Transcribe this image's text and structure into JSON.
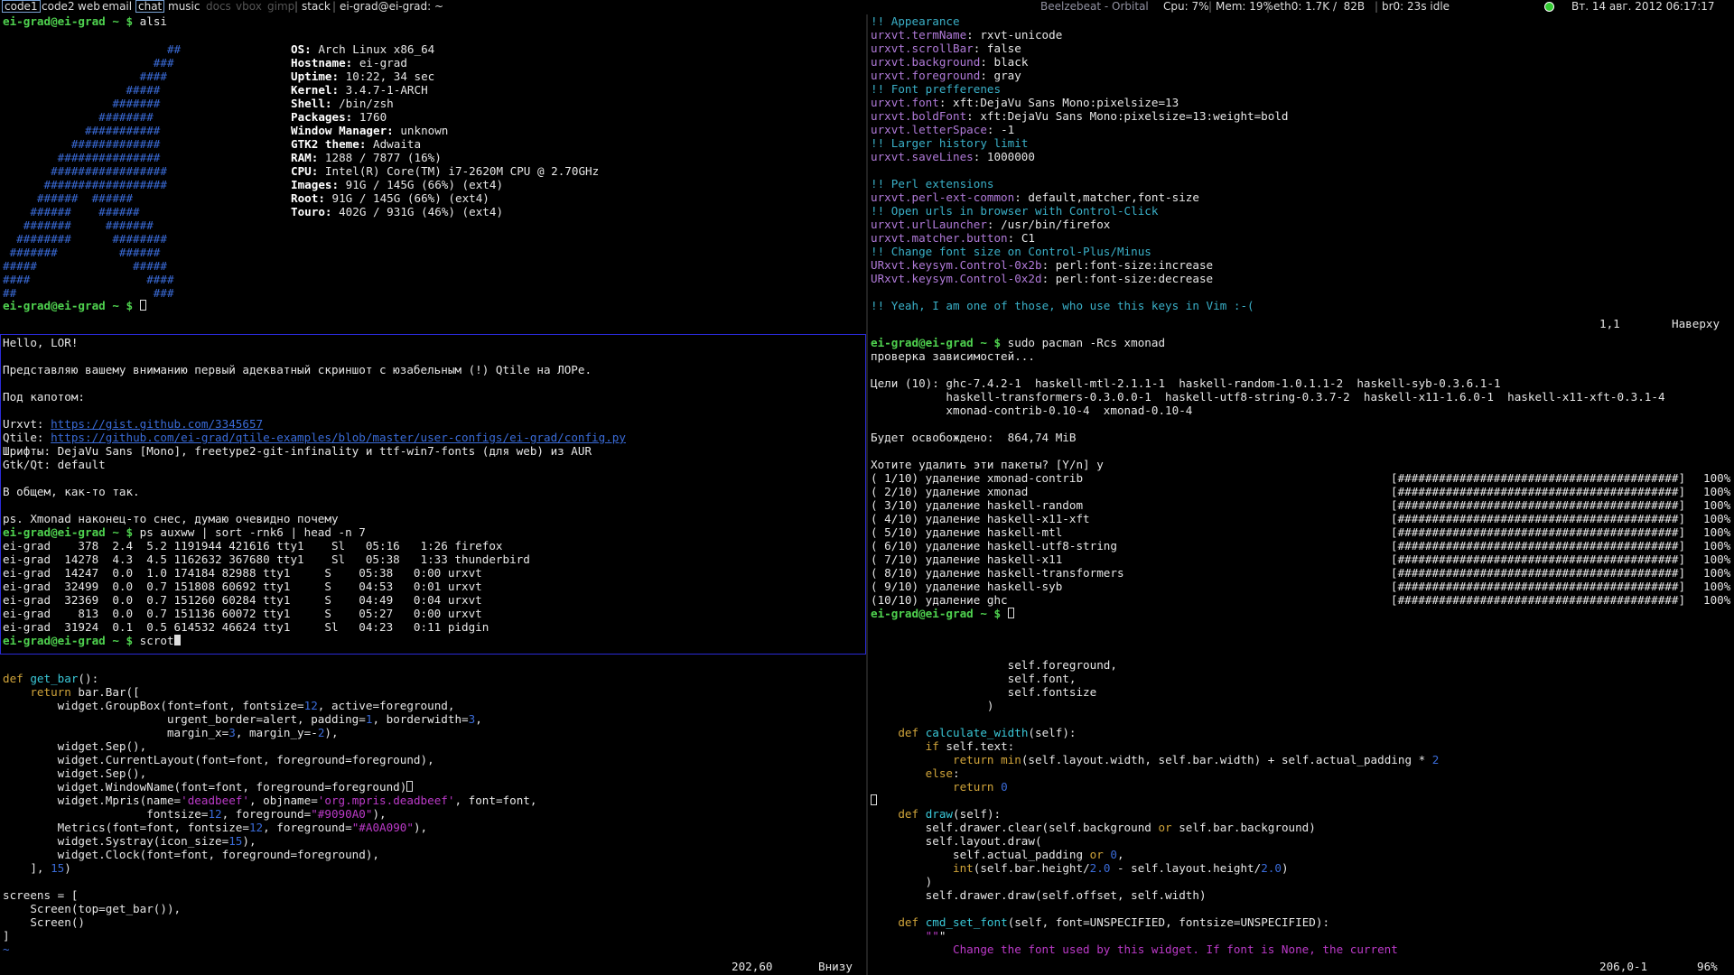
{
  "topbar": {
    "groups": [
      "code1",
      "code2",
      "web",
      "email",
      "chat",
      "music",
      "docs",
      "vbox",
      "gimp"
    ],
    "active_group": "code1",
    "current_group": "chat",
    "layout": "stack",
    "window_title": "ei-grad@ei-grad: ~",
    "now_playing": "Beelzebeat - Orbital",
    "cpu": "Cpu: 7%",
    "mem": "Mem: 19%",
    "eth0": "eth0: 1.7K /  82B",
    "br0": "br0: 23s idle",
    "clock": "Вт. 14 авг. 2012 06:17:17"
  },
  "colors": {
    "prompt": "#4fd24f",
    "path": "#3a6bd8",
    "focus_border": "#2a2ad8",
    "background": "#000000"
  },
  "alsi": {
    "prompt": "ei-grad@ei-grad ~ $ ",
    "command": "alsi",
    "logo": [
      "        ##",
      "       ###",
      "      ####",
      "     #####",
      "    #######",
      "   ########",
      "  ###########",
      " #############",
      "###############",
      "#################",
      "##################",
      "######  ######",
      "######    ######",
      "#######     #######",
      "########      ########",
      "#######         ######",
      "#####              #####",
      "####                 ####",
      "##                    ###"
    ],
    "info": [
      {
        "k": "OS:",
        "v": " Arch Linux x86_64"
      },
      {
        "k": "Hostname:",
        "v": " ei-grad"
      },
      {
        "k": "Uptime:",
        "v": " 10:22, 34 sec"
      },
      {
        "k": "Kernel:",
        "v": " 3.4.7-1-ARCH"
      },
      {
        "k": "Shell:",
        "v": " /bin/zsh"
      },
      {
        "k": "Packages:",
        "v": " 1760"
      },
      {
        "k": "Window Manager:",
        "v": " unknown"
      },
      {
        "k": "GTK2 theme:",
        "v": " Adwaita"
      },
      {
        "k": "RAM:",
        "v": " 1288 / 7877 (16%)"
      },
      {
        "k": "CPU:",
        "v": " Intel(R) Core(TM) i7-2620M CPU @ 2.70GHz"
      },
      {
        "k": "Images:",
        "v": " 91G / 145G (66%) (ext4)"
      },
      {
        "k": "Root:",
        "v": " 91G / 145G (66%) (ext4)"
      },
      {
        "k": "Touro:",
        "v": " 402G / 931G (46%) (ext4)"
      }
    ],
    "prompt2": "ei-grad@ei-grad ~ $ "
  },
  "xres": {
    "lines": [
      [
        "!",
        "! Appearance"
      ],
      [
        "urxvt.termName",
        ": rxvt-unicode"
      ],
      [
        "urxvt.scrollBar",
        ": false"
      ],
      [
        "urxvt.background",
        ": black"
      ],
      [
        "urxvt.foreground",
        ": gray"
      ],
      [
        "!",
        "! Font prefferenes"
      ],
      [
        "urxvt.font",
        ": xft:DejaVu Sans Mono:pixelsize=13"
      ],
      [
        "urxvt.boldFont",
        ": xft:DejaVu Sans Mono:pixelsize=13:weight=bold"
      ],
      [
        "urxvt.letterSpace",
        ": -1"
      ],
      [
        "!",
        "! Larger history limit"
      ],
      [
        "urxvt.saveLines",
        ": 1000000"
      ],
      [
        "",
        ""
      ],
      [
        "!",
        "! Perl extensions"
      ],
      [
        "urxvt.perl-ext-common",
        ": default,matcher,font-size"
      ],
      [
        "!",
        "! Open urls in browser with Control-Click"
      ],
      [
        "urxvt.urlLauncher",
        ": /usr/bin/firefox"
      ],
      [
        "urxvt.matcher.button",
        ": C1"
      ],
      [
        "!",
        "! Change font size on Control-Plus/Minus"
      ],
      [
        "URxvt.keysym.Control-0x2b",
        ": perl:font-size:increase"
      ],
      [
        "URxvt.keysym.Control-0x2d",
        ": perl:font-size:decrease"
      ],
      [
        "",
        ""
      ],
      [
        "!",
        "! Yeah, I am one of those, who use this keys in Vim :-("
      ]
    ],
    "status_pos": "1,1",
    "status_where": "Наверху"
  },
  "lor": {
    "text": [
      "Hello, LOR!",
      "",
      "Представляю вашему вниманию первый адекватный скриншот с юзабельным (!) Qtile на ЛОРе.",
      "",
      "Под капотом:",
      ""
    ],
    "urxvt_label": "Urxvt: ",
    "urxvt_link": "https://gist.github.com/3345657",
    "qtile_label": "Qtile: ",
    "qtile_link": "https://github.com/ei-grad/qtile-examples/blob/master/user-configs/ei-grad/config.py",
    "text2": [
      "Шрифты: DejaVu Sans [Mono], freetype2-git-infinality и ttf-win7-fonts (для web) из AUR",
      "Gtk/Qt: default",
      "",
      "В общем, как-то так.",
      "",
      "ps. Xmonad наконец-то снес, думаю очевидно почему"
    ],
    "prompt": "ei-grad@ei-grad ~ $ ",
    "command": "ps auxww | sort -rnk6 | head -n 7",
    "ps": [
      "ei-grad    378  2.4  5.2 1191944 421616 tty1    Sl   05:16   1:26 firefox",
      "ei-grad  14278  4.3  4.5 1162632 367680 tty1    Sl   05:38   1:33 thunderbird",
      "ei-grad  14247  0.0  1.0 174184 82988 tty1     S    05:38   0:00 urxvt",
      "ei-grad  32499  0.0  0.7 151808 60692 tty1     S    04:53   0:01 urxvt",
      "ei-grad  32369  0.0  0.7 151260 60284 tty1     S    04:49   0:04 urxvt",
      "ei-grad    813  0.0  0.7 151136 60072 tty1     S    05:27   0:00 urxvt",
      "ei-grad  31924  0.1  0.5 614532 46624 tty1     Sl   04:23   0:11 pidgin"
    ],
    "prompt2": "ei-grad@ei-grad ~ $ ",
    "command2": "scrot"
  },
  "pacman": {
    "prompt": "ei-grad@ei-grad ~ $ ",
    "command": "sudo pacman -Rcs xmonad",
    "head": [
      "проверка зависимостей...",
      "",
      "Цели (10): ghc-7.4.2-1  haskell-mtl-2.1.1-1  haskell-random-1.0.1.1-2  haskell-syb-0.3.6.1-1",
      "           haskell-transformers-0.3.0.0-1  haskell-utf8-string-0.3.7-2  haskell-x11-1.6.0-1  haskell-x11-xft-0.3.1-4",
      "           xmonad-contrib-0.10-4  xmonad-0.10-4",
      "",
      "Будет освобождено:  864,74 MiB",
      "",
      "Хотите удалить эти пакеты? [Y/n] y"
    ],
    "steps": [
      [
        "( 1/10) удаление xmonad-contrib",
        "100%"
      ],
      [
        "( 2/10) удаление xmonad",
        "100%"
      ],
      [
        "( 3/10) удаление haskell-random",
        "100%"
      ],
      [
        "( 4/10) удаление haskell-x11-xft",
        "100%"
      ],
      [
        "( 5/10) удаление haskell-mtl",
        "100%"
      ],
      [
        "( 6/10) удаление haskell-utf8-string",
        "100%"
      ],
      [
        "( 7/10) удаление haskell-x11",
        "100%"
      ],
      [
        "( 8/10) удаление haskell-transformers",
        "100%"
      ],
      [
        "( 9/10) удаление haskell-syb",
        "100%"
      ],
      [
        "(10/10) удаление ghc",
        "100%"
      ]
    ],
    "bar": "[#########################################]",
    "prompt2": "ei-grad@ei-grad ~ $ "
  },
  "config_py": {
    "lines": [
      "",
      "def get_bar():",
      "    return bar.Bar([",
      "        widget.GroupBox(font=font, fontsize=12, active=foreground,",
      "                        urgent_border=alert, padding=1, borderwidth=3,",
      "                        margin_x=3, margin_y=-2),",
      "        widget.Sep(),",
      "        widget.CurrentLayout(font=font, foreground=foreground),",
      "        widget.Sep(),",
      "        widget.WindowName(font=font, foreground=foreground)",
      "        widget.Mpris(name='deadbeef', objname='org.mpris.deadbeef', font=font,",
      "                     fontsize=12, foreground=\"#9090A0\"),",
      "        Metrics(font=font, fontsize=12, foreground=\"#A0A090\"),",
      "        widget.Systray(icon_size=15),",
      "        widget.Clock(font=font, foreground=foreground),",
      "    ], 15)",
      "",
      "screens = [",
      "    Screen(top=get_bar()),",
      "    Screen()",
      "]",
      "~"
    ],
    "status_pos": "202,60",
    "status_where": "Внизу"
  },
  "widget_py": {
    "lines": [
      "                    self.foreground,",
      "                    self.font,",
      "                    self.fontsize",
      "                 )",
      "",
      "    def calculate_width(self):",
      "        if self.text:",
      "            return min(self.layout.width, self.bar.width) + self.actual_padding * 2",
      "        else:",
      "            return 0",
      "",
      "    def draw(self):",
      "        self.drawer.clear(self.background or self.bar.background)",
      "        self.layout.draw(",
      "            self.actual_padding or 0,",
      "            int(self.bar.height/2.0 - self.layout.height/2.0)",
      "        )",
      "        self.drawer.draw(self.offset, self.width)",
      "",
      "    def cmd_set_font(self, font=UNSPECIFIED, fontsize=UNSPECIFIED):",
      "        \"\"\"",
      "            Change the font used by this widget. If font is None, the current"
    ],
    "status_pos": "206,0-1",
    "status_pct": "96%"
  }
}
